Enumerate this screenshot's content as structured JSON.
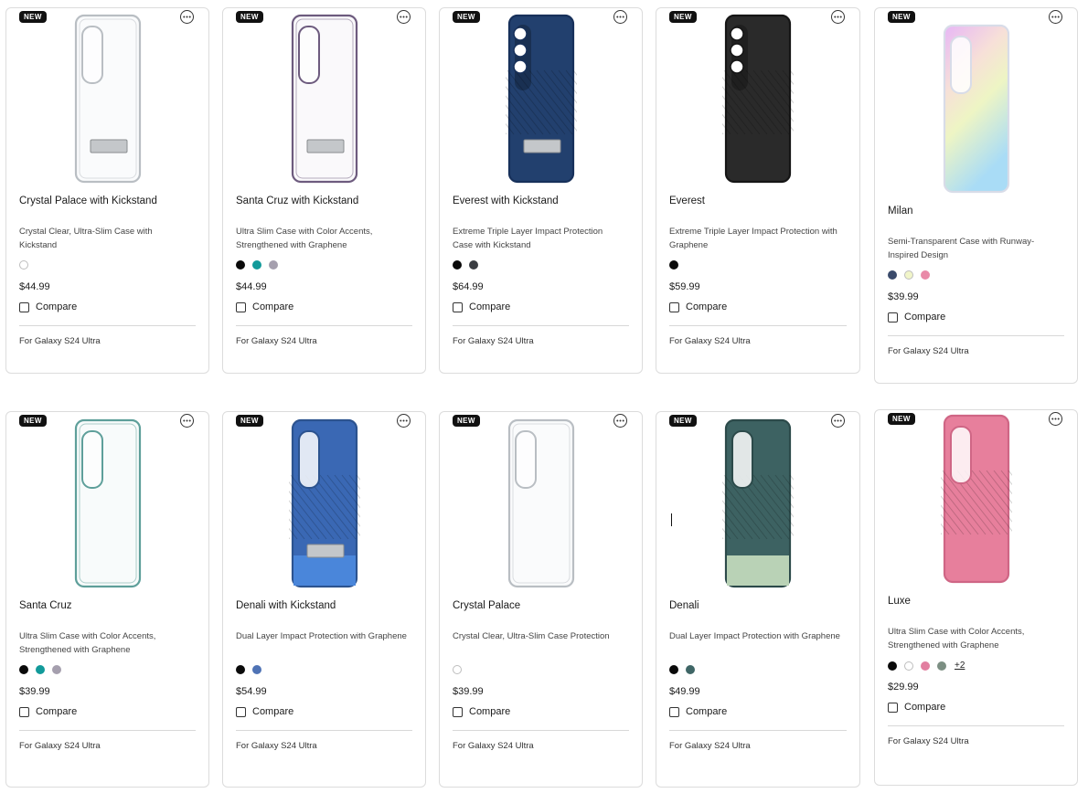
{
  "products": [
    {
      "badge": "NEW",
      "title": "Crystal Palace with Kickstand",
      "description": "Crystal Clear, Ultra-Slim Case with Kickstand",
      "swatches": [
        "#ffffff"
      ],
      "price": "$44.99",
      "compare": "Compare",
      "compatibility": "For Galaxy S24 Ultra",
      "image": {
        "body": "#f2f4f6",
        "rim": "#b9bec3",
        "opacity": 0.35,
        "kickstand": true,
        "ribbed": false,
        "bottom": null
      }
    },
    {
      "badge": "NEW",
      "title": "Santa Cruz with Kickstand",
      "description": "Ultra Slim Case with Color Accents, Strengthened with Graphene",
      "swatches": [
        "#0a0a0a",
        "#129a9a",
        "#a59fae"
      ],
      "price": "$44.99",
      "compare": "Compare",
      "compatibility": "For Galaxy S24 Ultra",
      "image": {
        "body": "#f1eff4",
        "rim": "#6d5b7e",
        "opacity": 0.35,
        "kickstand": true,
        "ribbed": false,
        "bottom": null
      }
    },
    {
      "badge": "NEW",
      "title": "Everest with Kickstand",
      "description": "Extreme Triple Layer Impact Protection Case with Kickstand",
      "swatches": [
        "#0a0a0a",
        "#3a3d42"
      ],
      "price": "$64.99",
      "compare": "Compare",
      "compatibility": "For Galaxy S24 Ultra",
      "image": {
        "body": "#22406e",
        "rim": "#17305a",
        "opacity": 1,
        "kickstand": true,
        "ribbed": true,
        "bottom": null
      }
    },
    {
      "badge": "NEW",
      "title": "Everest",
      "description": "Extreme Triple Layer Impact Protection with Graphene",
      "swatches": [
        "#0a0a0a"
      ],
      "price": "$59.99",
      "compare": "Compare",
      "compatibility": "For Galaxy S24 Ultra",
      "image": {
        "body": "#2a2a2a",
        "rim": "#151515",
        "opacity": 1,
        "kickstand": false,
        "ribbed": true,
        "bottom": null
      }
    },
    {
      "badge": "NEW",
      "title": "Milan",
      "description": "Semi-Transparent Case with Runway-Inspired Design",
      "swatches": [
        "#3a4a6b",
        "#f1f5c9",
        "#e98aa8"
      ],
      "price": "$39.99",
      "compare": "Compare",
      "compatibility": "For Galaxy S24 Ultra",
      "image": {
        "body": "iridescent",
        "rim": "#d8dce8",
        "opacity": 1,
        "kickstand": false,
        "ribbed": false,
        "bottom": null
      }
    },
    {
      "badge": "NEW",
      "title": "Santa Cruz",
      "description": "Ultra Slim Case with Color Accents, Strengthened with Graphene",
      "swatches": [
        "#0a0a0a",
        "#129a9a",
        "#a59fae"
      ],
      "price": "$39.99",
      "compare": "Compare",
      "compatibility": "For Galaxy S24 Ultra",
      "image": {
        "body": "#eef6f5",
        "rim": "#5e9f9a",
        "opacity": 0.4,
        "kickstand": false,
        "ribbed": false,
        "bottom": null
      }
    },
    {
      "badge": "NEW",
      "title": "Denali with Kickstand",
      "description": "Dual Layer Impact Protection with Graphene",
      "swatches": [
        "#0a0a0a",
        "#4f73b5"
      ],
      "price": "$54.99",
      "compare": "Compare",
      "compatibility": "For Galaxy S24 Ultra",
      "image": {
        "body": "#3a68b4",
        "rim": "#2c538f",
        "opacity": 1,
        "kickstand": true,
        "ribbed": true,
        "bottom": "#4a86da"
      }
    },
    {
      "badge": "NEW",
      "title": "Crystal Palace",
      "description": "Crystal Clear, Ultra-Slim Case Protection",
      "swatches": [
        "#ffffff"
      ],
      "price": "$39.99",
      "compare": "Compare",
      "compatibility": "For Galaxy S24 Ultra",
      "image": {
        "body": "#f2f4f6",
        "rim": "#b9bec3",
        "opacity": 0.35,
        "kickstand": false,
        "ribbed": false,
        "bottom": null
      }
    },
    {
      "badge": "NEW",
      "title": "Denali",
      "description": "Dual Layer Impact Protection with Graphene",
      "swatches": [
        "#0a0a0a",
        "#3f6666"
      ],
      "price": "$49.99",
      "compare": "Compare",
      "compatibility": "For Galaxy S24 Ultra",
      "image": {
        "body": "#3d6262",
        "rim": "#2c4a4a",
        "opacity": 1,
        "kickstand": false,
        "ribbed": true,
        "bottom": "#b9d2b6"
      }
    },
    {
      "badge": "NEW",
      "title": "Luxe",
      "description": "Ultra Slim Case with Color Accents, Strengthened with Graphene",
      "swatches": [
        "#0a0a0a",
        "#ffffff",
        "#e27fa0",
        "#7c8f83"
      ],
      "more_colors": "+2",
      "price": "$29.99",
      "compare": "Compare",
      "compatibility": "For Galaxy S24 Ultra",
      "image": {
        "body": "#e77f9c",
        "rim": "#cf6685",
        "opacity": 1,
        "kickstand": false,
        "ribbed": true,
        "bottom": null
      }
    }
  ]
}
